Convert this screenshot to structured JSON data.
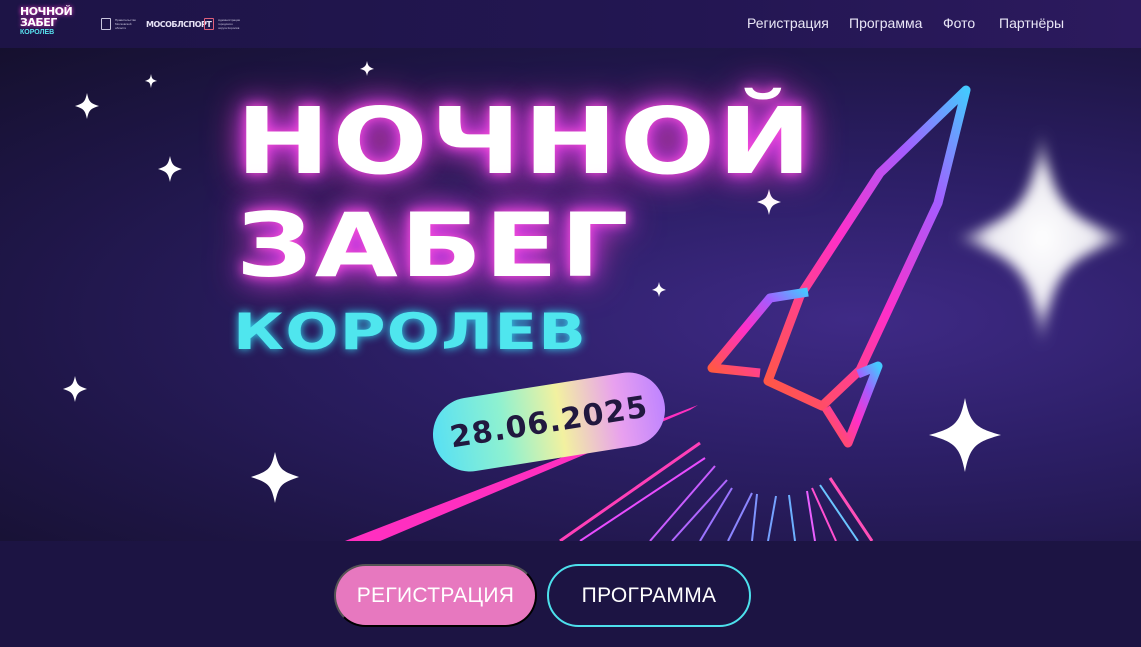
{
  "header": {
    "logo": {
      "line1": "НОЧНОЙ",
      "line2": "ЗАБЕГ",
      "line3": "КОРОЛЕВ"
    },
    "partners": [
      {
        "name": "Правительство Московской области"
      },
      {
        "name": "МОСОБЛСПОРТ"
      },
      {
        "name": "Администрация городского округа Королёв"
      }
    ],
    "nav": [
      {
        "label": "Регистрация"
      },
      {
        "label": "Программа"
      },
      {
        "label": "Фото"
      },
      {
        "label": "Партнёры"
      }
    ]
  },
  "hero": {
    "title_line1": "НОЧНОЙ",
    "title_line2": "ЗАБЕГ",
    "city": "КОРОЛЕВ",
    "date": "28.06.2025"
  },
  "actions": {
    "register_label": "РЕГИСТРАЦИЯ",
    "program_label": "ПРОГРАММА"
  },
  "colors": {
    "background": "#1b1440",
    "accent_pink": "#e778bf",
    "accent_cyan": "#4de0ec",
    "neon_magenta": "#ff3fd0"
  },
  "icons": [
    "sparkle-star-icon",
    "rocket-icon",
    "coat-of-arms-icon"
  ]
}
